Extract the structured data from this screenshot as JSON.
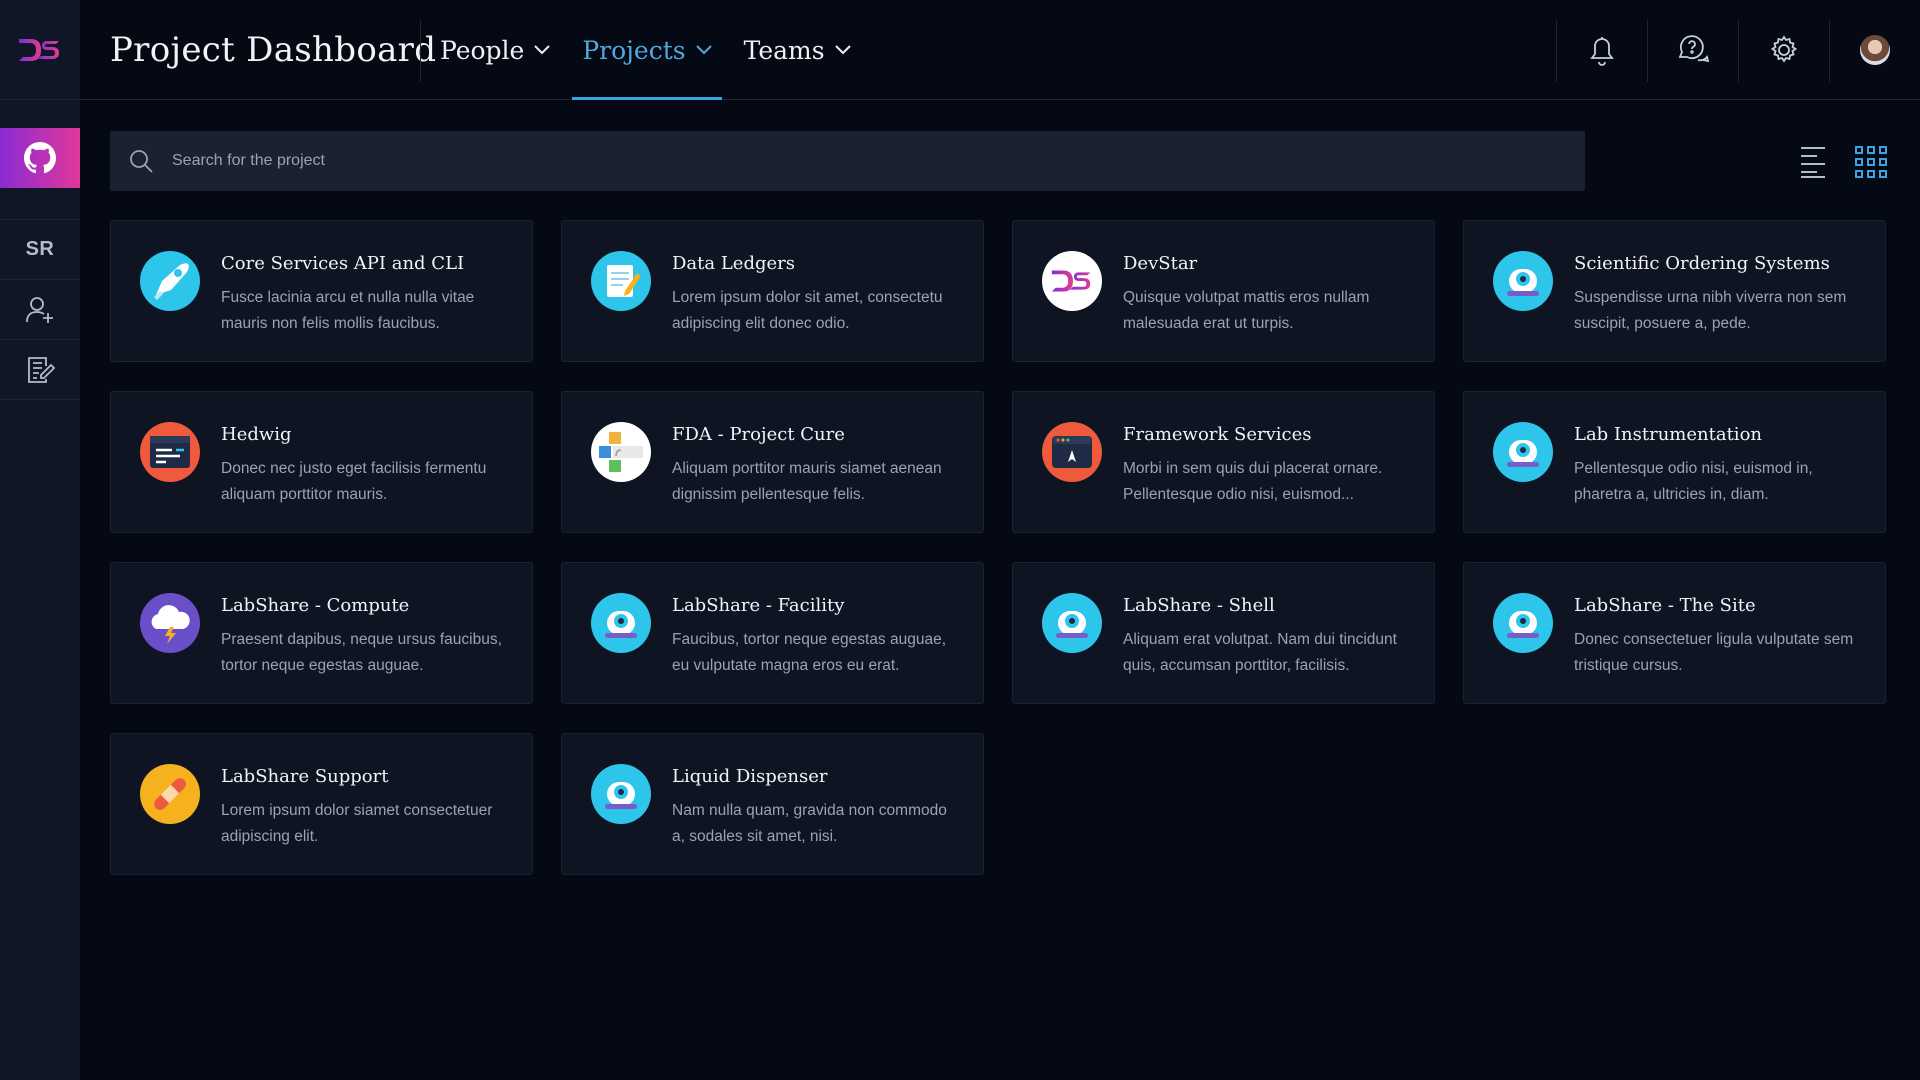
{
  "app": {
    "title": "Project Dashboard"
  },
  "nav": [
    {
      "label": "People",
      "active": false
    },
    {
      "label": "Projects",
      "active": true
    },
    {
      "label": "Teams",
      "active": false
    }
  ],
  "sidebar": {
    "sr_label": "SR"
  },
  "search": {
    "placeholder": "Search for the project"
  },
  "projects": [
    {
      "title": "Core Services API and CLI",
      "desc": "Fusce lacinia arcu et nulla nulla vitae mauris non felis mollis faucibus.",
      "icon": "rocket-icon"
    },
    {
      "title": "Data Ledgers",
      "desc": "Lorem ipsum dolor sit amet, consectetu adipiscing elit donec odio.",
      "icon": "notepad-icon"
    },
    {
      "title": "DevStar",
      "desc": "Quisque volutpat mattis eros nullam malesuada erat ut turpis.",
      "icon": "devstar-logo-icon"
    },
    {
      "title": "Scientific Ordering Systems",
      "desc": "Suspendisse urna nibh viverra non sem suscipit, posuere a, pede.",
      "icon": "robot-icon"
    },
    {
      "title": "Hedwig",
      "desc": "Donec nec justo eget facilisis fermentu aliquam porttitor mauris.",
      "icon": "code-window-icon"
    },
    {
      "title": "FDA - Project Cure",
      "desc": "Aliquam porttitor mauris siamet aenean dignissim pellentesque felis.",
      "icon": "cure-blocks-icon"
    },
    {
      "title": "Framework Services",
      "desc": "Morbi in sem quis dui placerat ornare. Pellentesque odio nisi, euismod...",
      "icon": "browser-rocket-icon"
    },
    {
      "title": "Lab Instrumentation",
      "desc": "Pellentesque odio nisi, euismod in, pharetra a, ultricies in, diam.",
      "icon": "robot-icon"
    },
    {
      "title": "LabShare - Compute",
      "desc": "Praesent dapibus, neque ursus faucibus, tortor neque egestas auguae.",
      "icon": "storm-cloud-icon"
    },
    {
      "title": "LabShare - Facility",
      "desc": "Faucibus, tortor neque egestas auguae, eu vulputate magna eros eu erat.",
      "icon": "robot-icon"
    },
    {
      "title": "LabShare - Shell",
      "desc": "Aliquam erat volutpat. Nam dui tincidunt quis, accumsan porttitor, facilisis.",
      "icon": "robot-icon"
    },
    {
      "title": "LabShare - The Site",
      "desc": "Donec consectetuer ligula vulputate sem tristique cursus.",
      "icon": "robot-icon"
    },
    {
      "title": "LabShare Support",
      "desc": "Lorem ipsum dolor siamet consectetuer adipiscing elit.",
      "icon": "bandage-icon"
    },
    {
      "title": "Liquid Dispenser",
      "desc": "Nam nulla quam, gravida non commodo a, sodales sit amet, nisi.",
      "icon": "robot-icon"
    }
  ],
  "colors": {
    "accent": "#3ba2e0",
    "brand_gradient_start": "#8a2bd3",
    "brand_gradient_end": "#e0389a",
    "background": "#050913",
    "card": "#0e1422"
  }
}
